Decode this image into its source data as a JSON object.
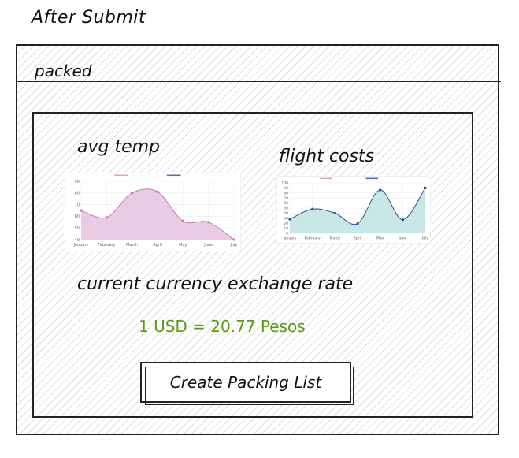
{
  "page": {
    "title": "After Submit"
  },
  "header": {
    "label": "packed"
  },
  "temp_chart_title": "avg temp",
  "flight_chart_title": "flight costs",
  "exchange": {
    "heading": "current currency exchange rate",
    "rate_text": "1 USD = 20.77 Pesos",
    "color": "#5a9a16"
  },
  "actions": {
    "create_label": "Create Packing List"
  },
  "chart_data": [
    {
      "type": "area",
      "categories": [
        "January",
        "February",
        "March",
        "April",
        "May",
        "June",
        "July"
      ],
      "values": [
        65,
        59,
        80,
        81,
        56,
        55,
        40
      ],
      "yticks": [
        40,
        50,
        60,
        70,
        80,
        90
      ],
      "ylim": [
        40,
        90
      ],
      "series_color": "#c47bb8",
      "fill_color": "#e6c2df",
      "legend_colors": [
        "#e7a1b9",
        "#4f6fb0"
      ]
    },
    {
      "type": "area",
      "categories": [
        "January",
        "February",
        "March",
        "April",
        "May",
        "June",
        "July"
      ],
      "values": [
        28,
        48,
        40,
        19,
        86,
        27,
        90
      ],
      "yticks": [
        0,
        10,
        20,
        30,
        40,
        50,
        60,
        70,
        80,
        90,
        100
      ],
      "ylim": [
        0,
        100
      ],
      "series_color": "#2b4f8c",
      "fill_color": "#bfe3e3",
      "legend_colors": [
        "#e7a1b9",
        "#4f6fb0"
      ]
    }
  ]
}
